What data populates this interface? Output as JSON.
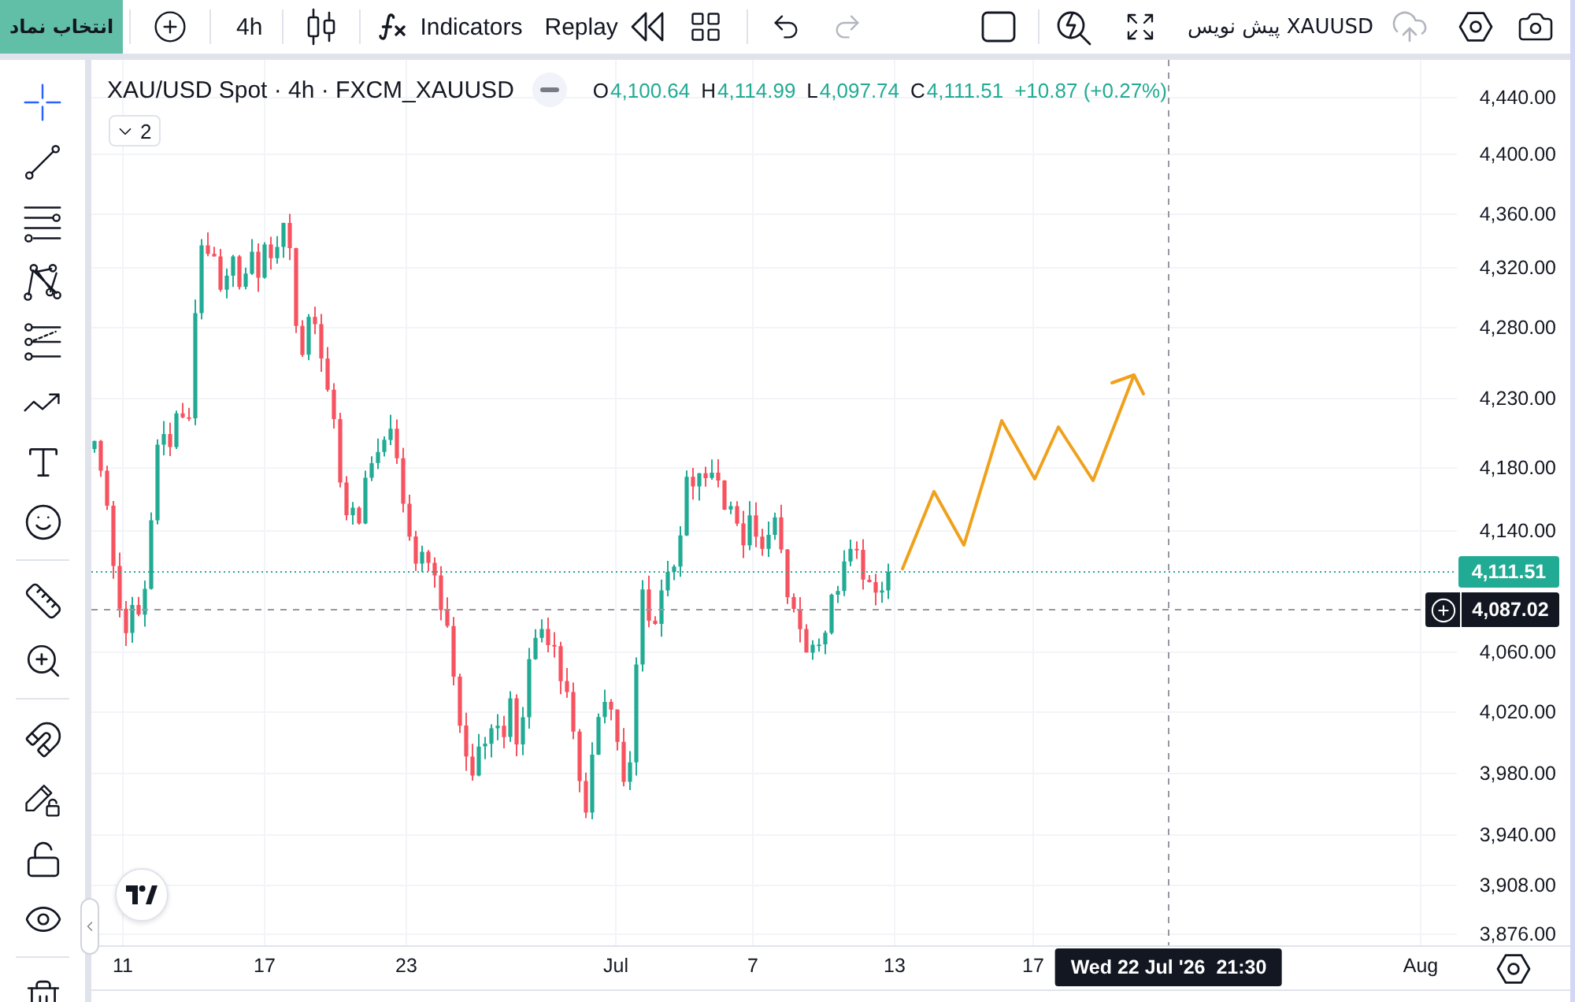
{
  "top_toolbar": {
    "symbol_button": "انتخاب نماد",
    "interval": "4h",
    "indicators": "Indicators",
    "replay": "Replay",
    "layout_name": "XAUUSD پیش نویس",
    "undo": {
      "disabled": false
    },
    "redo": {
      "disabled": true
    },
    "cloud_save": {
      "disabled": true
    }
  },
  "drawing_toolbar": {
    "groups": [
      {
        "tools": [
          {
            "kind": "crosshair",
            "selected": true
          },
          {
            "kind": "trend-line",
            "selected": false
          },
          {
            "kind": "horizontal-lines",
            "selected": false
          },
          {
            "kind": "pattern",
            "selected": false
          },
          {
            "kind": "channel",
            "selected": false
          },
          {
            "kind": "forecast",
            "selected": false
          },
          {
            "kind": "text",
            "selected": false
          },
          {
            "kind": "emoji",
            "selected": false
          }
        ]
      },
      {
        "tools": [
          {
            "kind": "ruler",
            "selected": false
          },
          {
            "kind": "zoom-in",
            "selected": false
          }
        ]
      },
      {
        "tools": [
          {
            "kind": "magnet",
            "selected": false
          },
          {
            "kind": "lock-drawings",
            "selected": false
          },
          {
            "kind": "lock",
            "selected": false
          },
          {
            "kind": "hide",
            "selected": false
          }
        ]
      },
      {
        "tools": [
          {
            "kind": "trash",
            "selected": false
          }
        ]
      }
    ]
  },
  "legend": {
    "title": "XAU/USD Spot · 4h · FXCM_XAUUSD",
    "ohlc": [
      {
        "label": "O",
        "value": "4,100.64"
      },
      {
        "label": "H",
        "value": "4,114.99"
      },
      {
        "label": "L",
        "value": "4,097.74"
      },
      {
        "label": "C",
        "value": "4,111.51"
      }
    ],
    "change": "+10.87 (+0.27%)",
    "indicator_count": "2"
  },
  "price_axis": {
    "labels": [
      "4,440.00",
      "4,400.00",
      "4,360.00",
      "4,320.00",
      "4,280.00",
      "4,230.00",
      "4,180.00",
      "4,140.00",
      "4,060.00",
      "4,020.00",
      "3,980.00",
      "3,940.00",
      "3,908.00",
      "3,876.00"
    ],
    "last_price": "4,111.51",
    "crosshair_price": "4,087.02"
  },
  "time_axis": {
    "labels": [
      "11",
      "17",
      "23",
      "Jul",
      "7",
      "13",
      "17",
      "Aug"
    ],
    "crosshair_time": "Wed 22 Jul '26  21:30"
  }
}
